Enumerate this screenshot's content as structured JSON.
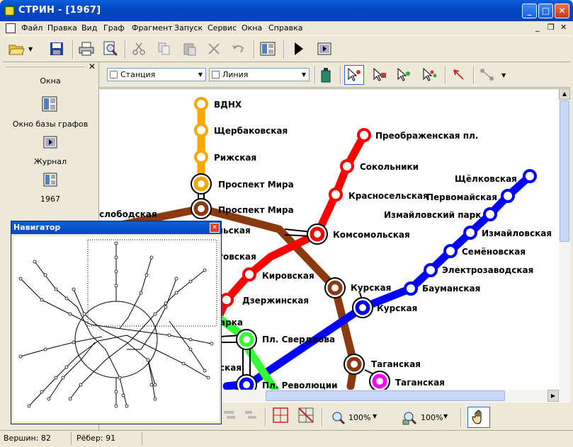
{
  "window": {
    "title": "СТРИН - [1967]"
  },
  "menu": [
    "Файл",
    "Правка",
    "Вид",
    "Граф",
    "Фрагмент",
    "Запуск",
    "Сервис",
    "Окна",
    "Справка"
  ],
  "left_panel": {
    "title": "Окна",
    "items": [
      {
        "label": "Окно базы графов"
      },
      {
        "label": "Журнал"
      },
      {
        "label": "1967"
      }
    ]
  },
  "toolbar2": {
    "station_combo": "Станция",
    "line_combo": "Линия"
  },
  "toolbar3": {
    "zoom1": "100%",
    "zoom2": "100%"
  },
  "navigator": {
    "title": "Навигатор"
  },
  "status": {
    "vertices": "Вершин: 82",
    "edges": "Рёбер: 91"
  },
  "colors": {
    "orange": "#ffa500",
    "brown": "#8b3a0f",
    "red": "#ff0000",
    "blue": "#0000ff",
    "green": "#33ff33",
    "magenta": "#ff00ff",
    "black": "#000000"
  },
  "map": {
    "stations": [
      {
        "name": "ВДНХ"
      },
      {
        "name": "Щербаковская"
      },
      {
        "name": "Рижская"
      },
      {
        "name": "Проспект Мира"
      },
      {
        "name": "Проспект Мира"
      },
      {
        "name": "Преображенская пл."
      },
      {
        "name": "Сокольники"
      },
      {
        "name": "Красносельская"
      },
      {
        "name": "Комсомольская"
      },
      {
        "name": "Кировская"
      },
      {
        "name": "Дзержинская"
      },
      {
        "name": "Курская"
      },
      {
        "name": "Курская"
      },
      {
        "name": "Щёлковская"
      },
      {
        "name": "Первомайская"
      },
      {
        "name": "Измайловский парк"
      },
      {
        "name": "Измайловская"
      },
      {
        "name": "Семёновская"
      },
      {
        "name": "Электрозаводская"
      },
      {
        "name": "Бауманская"
      },
      {
        "name": "Пл. Свердлова"
      },
      {
        "name": "Таганская"
      },
      {
        "name": "Таганская"
      },
      {
        "name": "Пл. Революции"
      }
    ],
    "partial_labels": [
      "еслободская",
      "ольская",
      "товская",
      "арка",
      "ская"
    ]
  }
}
